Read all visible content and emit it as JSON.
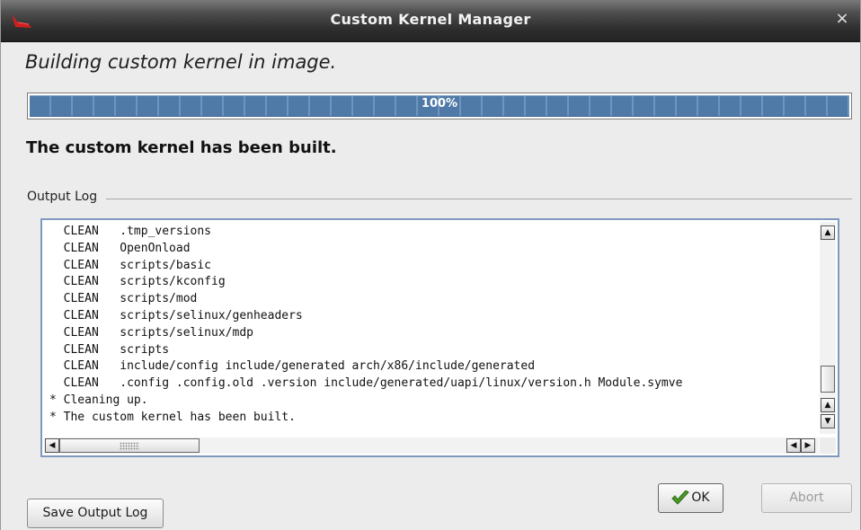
{
  "window": {
    "title": "Custom Kernel Manager",
    "close_glyph": "×"
  },
  "heading": "Building custom kernel in image.",
  "progress": {
    "value": 1.0,
    "label": "100%"
  },
  "status": "The custom kernel has been built.",
  "output_log": {
    "label": "Output Log",
    "lines": [
      "  CLEAN   .tmp_versions",
      "  CLEAN   OpenOnload",
      "  CLEAN   scripts/basic",
      "  CLEAN   scripts/kconfig",
      "  CLEAN   scripts/mod",
      "  CLEAN   scripts/selinux/genheaders",
      "  CLEAN   scripts/selinux/mdp",
      "  CLEAN   scripts",
      "  CLEAN   include/config include/generated arch/x86/include/generated",
      "  CLEAN   .config .config.old .version include/generated/uapi/linux/version.h Module.symve",
      "* Cleaning up.",
      "* The custom kernel has been built."
    ]
  },
  "buttons": {
    "save": "Save Output Log",
    "ok": "OK",
    "abort": "Abort"
  },
  "icons": {
    "title": "app-logo-icon",
    "ok": "checkmark-icon"
  }
}
